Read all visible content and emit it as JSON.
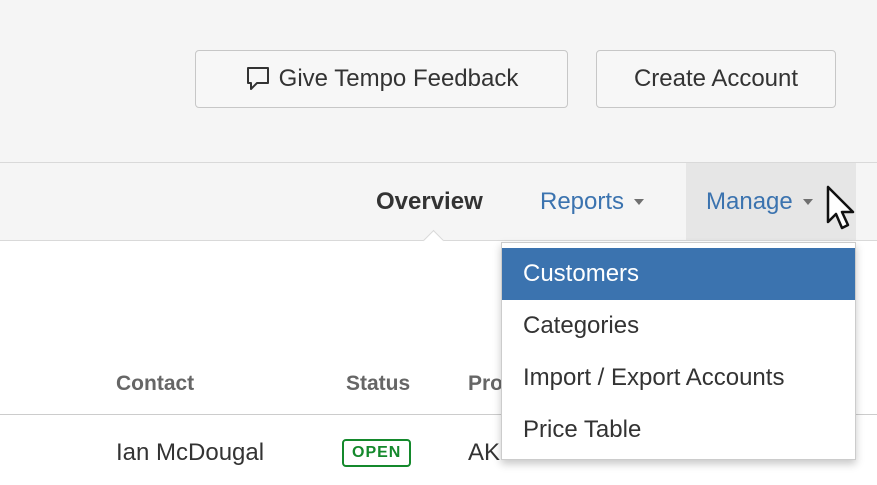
{
  "header": {
    "feedback_label": "Give Tempo Feedback",
    "feedback_icon": "speech-bubble-icon",
    "create_account_label": "Create Account"
  },
  "nav": {
    "overview": "Overview",
    "reports": "Reports",
    "manage": "Manage",
    "active_tab": "Overview"
  },
  "table": {
    "columns": [
      "Contact",
      "Status",
      "Pro"
    ],
    "rows": [
      {
        "contact": "Ian McDougal",
        "status": "OPEN",
        "product": "AK"
      }
    ]
  },
  "manage_menu": {
    "items": [
      "Customers",
      "Categories",
      "Import / Export Accounts",
      "Price Table"
    ],
    "highlighted": "Customers"
  },
  "colors": {
    "link": "#3b73af",
    "highlight": "#3b73af",
    "status_open": "#14892c",
    "toolbar_bg": "#f5f5f5"
  }
}
